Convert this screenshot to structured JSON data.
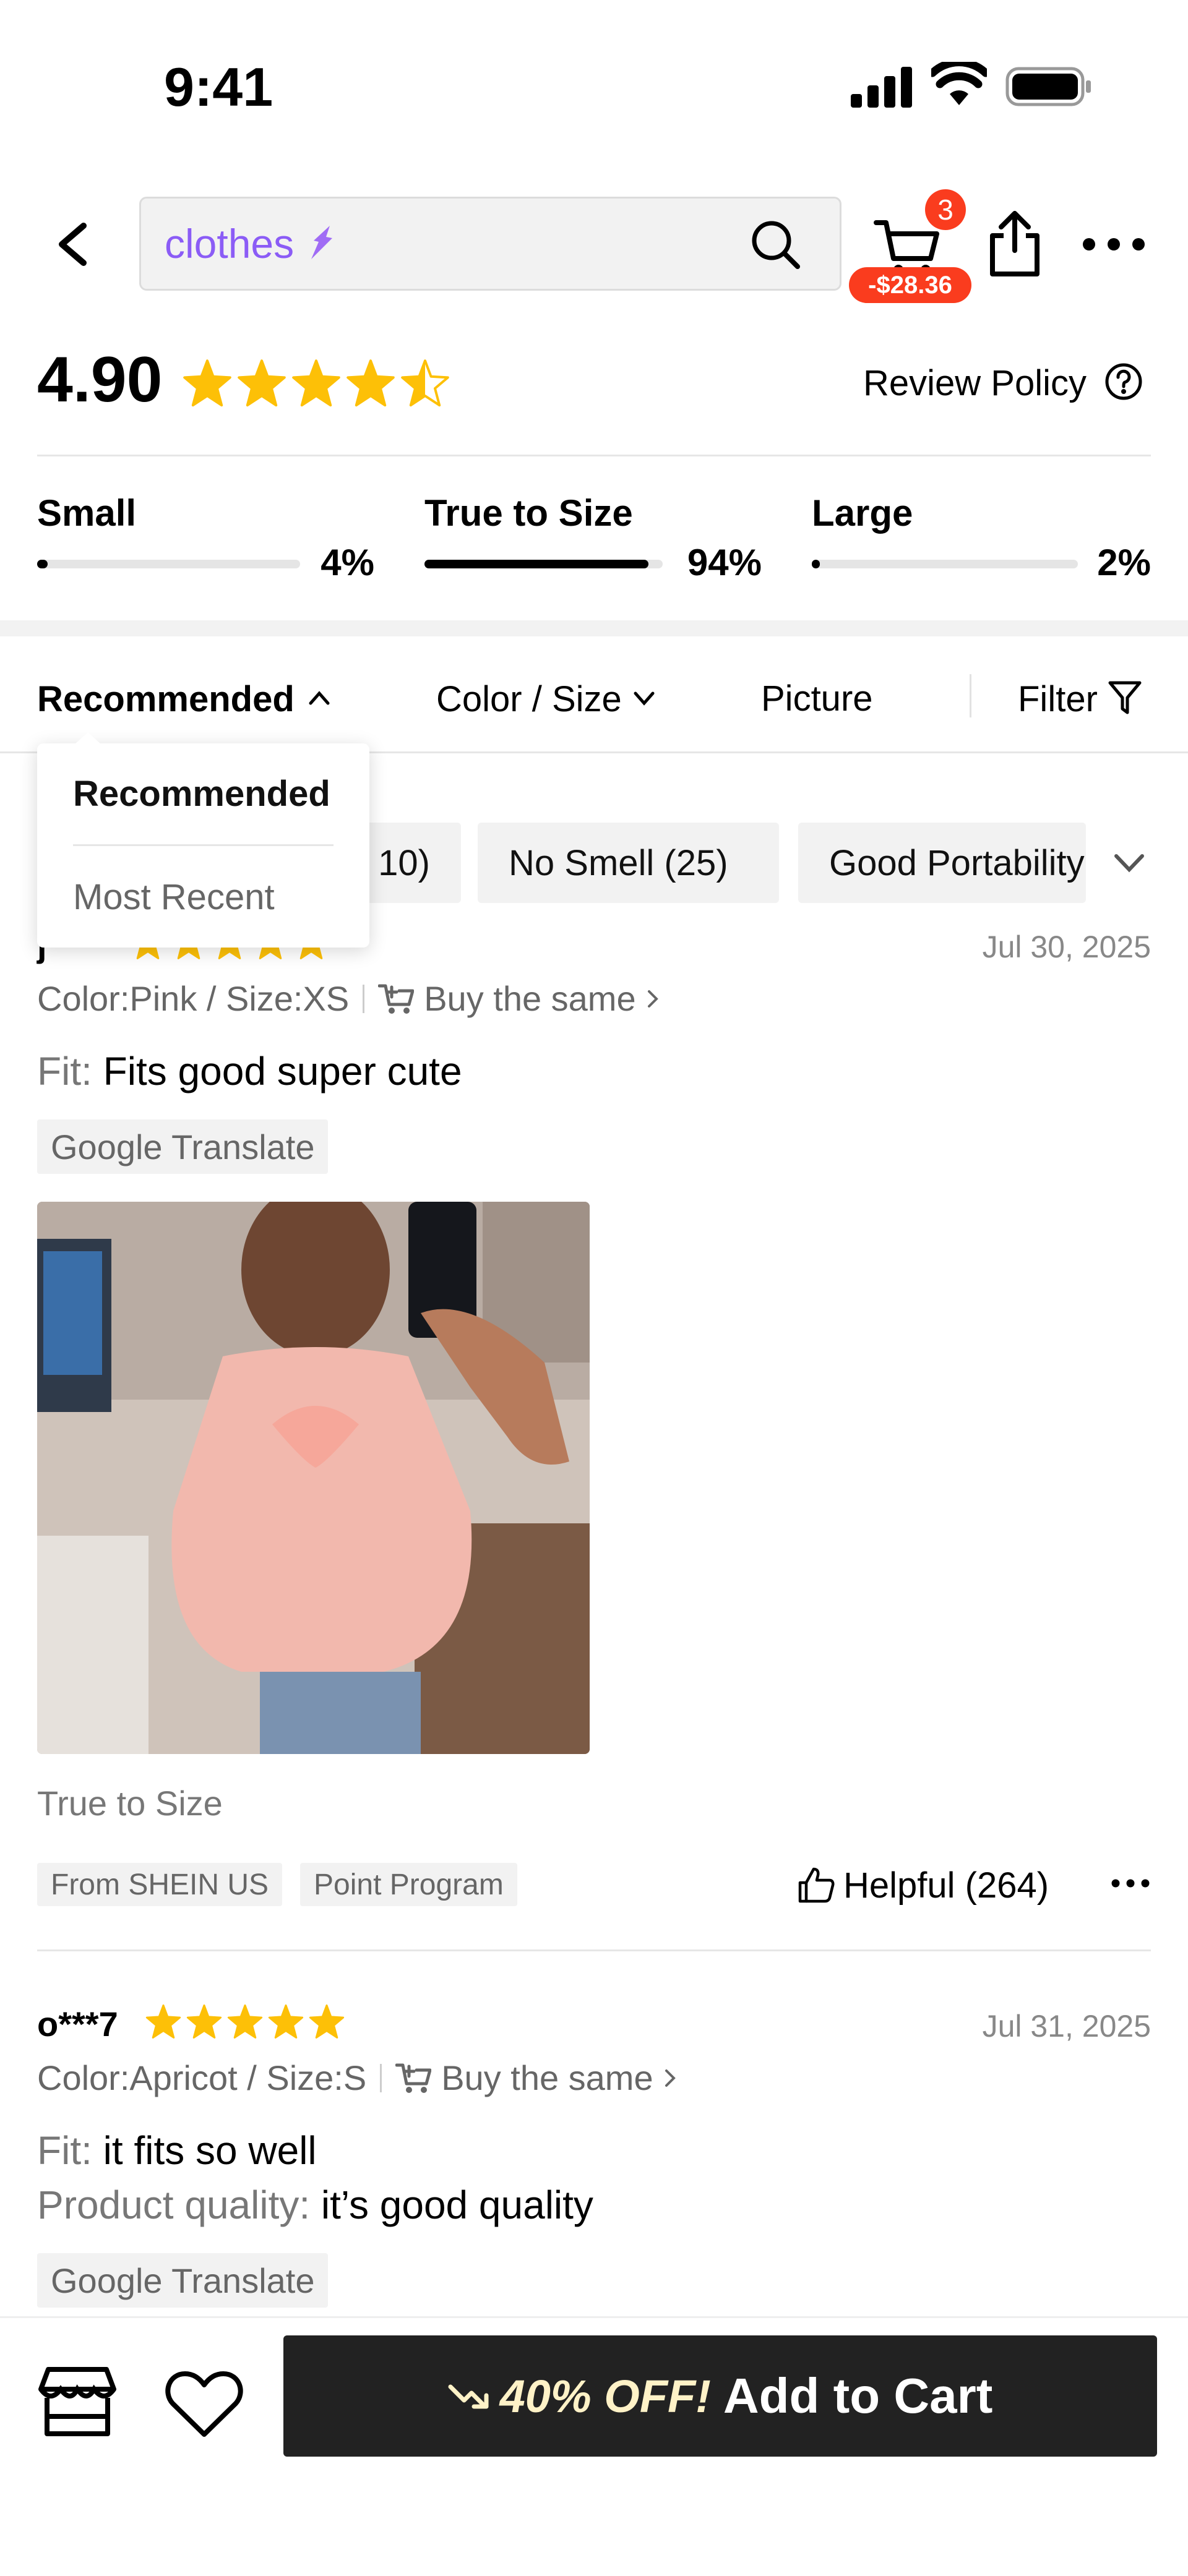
{
  "status_bar": {
    "time": "9:41"
  },
  "header": {
    "search_text": "clothes",
    "cart_badge": "3",
    "cart_discount": "-$28.36"
  },
  "rating": {
    "score": "4.90",
    "stars": 4.5,
    "review_policy": "Review Policy"
  },
  "fit": [
    {
      "label": "Small",
      "pct": "4%",
      "value": 0.04
    },
    {
      "label": "True to Size",
      "pct": "94%",
      "value": 0.94
    },
    {
      "label": "Large",
      "pct": "2%",
      "value": 0.02
    }
  ],
  "sort_bar": {
    "recommended": "Recommended",
    "color_size": "Color / Size",
    "picture": "Picture",
    "filter": "Filter"
  },
  "sort_dropdown": {
    "options": [
      "Recommended",
      "Most Recent"
    ],
    "selected": "Recommended"
  },
  "chips": [
    "10)",
    "No Smell (25)",
    "Good Portability"
  ],
  "reviews": [
    {
      "user": "j",
      "stars": 5,
      "date": "Jul 30, 2025",
      "variant": "Color:Pink / Size:XS",
      "buy_same": "Buy the same",
      "lines": [
        {
          "key": "Fit:",
          "value": "Fits good super cute"
        }
      ],
      "translate": "Google Translate",
      "fit_note": "True to Size",
      "tags": [
        "From SHEIN US",
        "Point Program"
      ],
      "helpful": "Helpful (264)"
    },
    {
      "user": "o***7",
      "stars": 5,
      "date": "Jul 31, 2025",
      "variant": "Color:Apricot / Size:S",
      "buy_same": "Buy the same",
      "lines": [
        {
          "key": "Fit:",
          "value": "it fits so well"
        },
        {
          "key": "Product quality:",
          "value": "it’s good quality"
        }
      ],
      "translate": "Google Translate"
    }
  ],
  "bottom_bar": {
    "promo": "40% OFF!",
    "cta": "Add to Cart"
  },
  "colors": {
    "accent_purple": "#8b5cf6",
    "badge_red": "#fa3c1e",
    "star_gold": "#fdc007",
    "cta_bg": "#222222",
    "promo_yellow": "#fff2c7"
  }
}
